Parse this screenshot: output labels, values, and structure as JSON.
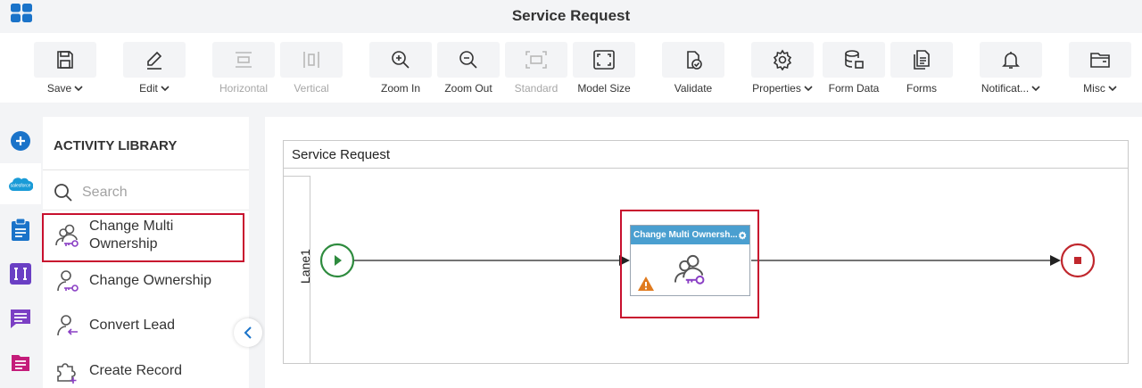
{
  "window": {
    "title": "Service Request"
  },
  "toolbar": {
    "save": "Save",
    "edit": "Edit",
    "horizontal": "Horizontal",
    "vertical": "Vertical",
    "zoom_in": "Zoom In",
    "zoom_out": "Zoom Out",
    "standard": "Standard",
    "model_size": "Model Size",
    "validate": "Validate",
    "properties": "Properties",
    "form_data": "Form Data",
    "forms": "Forms",
    "notifications": "Notificat...",
    "misc": "Misc"
  },
  "rail": {
    "items": [
      "add-icon",
      "salesforce-icon",
      "clipboard-icon",
      "integration-icon",
      "message-icon",
      "document-icon"
    ],
    "salesforce_text": "salesforce"
  },
  "library": {
    "title": "ACTIVITY LIBRARY",
    "search_placeholder": "Search",
    "items": [
      {
        "label_line1": "Change Multi",
        "label_line2": "Ownership",
        "icon": "change-multi-ownership-icon"
      },
      {
        "label": "Change Ownership",
        "icon": "change-ownership-icon"
      },
      {
        "label": "Convert Lead",
        "icon": "convert-lead-icon"
      },
      {
        "label": "Create Record",
        "icon": "create-record-icon"
      }
    ]
  },
  "canvas": {
    "pool_title": "Service Request",
    "lane_label": "Lane1",
    "task_title": "Change Multi Ownersh...",
    "colors": {
      "start": "#2e8b3e",
      "end": "#c0272d",
      "task_header": "#4a9fd0",
      "highlight": "#c8102e",
      "accent": "#1a73c9"
    }
  }
}
